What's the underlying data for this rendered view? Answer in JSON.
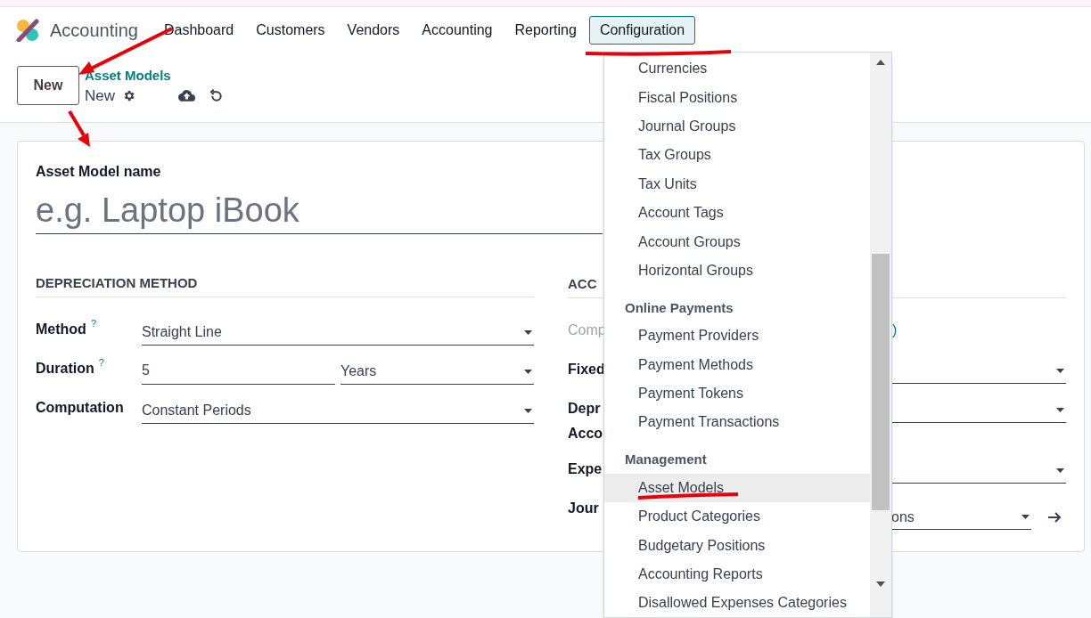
{
  "app": {
    "name": "Accounting"
  },
  "nav": [
    {
      "label": "Dashboard",
      "selected": false
    },
    {
      "label": "Customers",
      "selected": false
    },
    {
      "label": "Vendors",
      "selected": false
    },
    {
      "label": "Accounting",
      "selected": false
    },
    {
      "label": "Reporting",
      "selected": false
    },
    {
      "label": "Configuration",
      "selected": true
    }
  ],
  "control_panel": {
    "new_button": "New",
    "breadcrumb": "Asset Models",
    "record": "New"
  },
  "form": {
    "name_label": "Asset Model name",
    "name_placeholder": "e.g. Laptop iBook",
    "left_section": {
      "title": "DEPRECIATION METHOD",
      "rows": [
        {
          "label": "Method",
          "help": "?",
          "kind": "select",
          "value": "Straight Line"
        },
        {
          "label": "Duration",
          "help": "?",
          "kind": "duration",
          "value": "5",
          "unit": "Years"
        },
        {
          "label": "Computation",
          "kind": "select",
          "value": "Constant Periods"
        }
      ]
    },
    "right_section": {
      "title": "ACC",
      "rows": [
        {
          "label": "Comp",
          "kind": "link",
          "value": ")"
        },
        {
          "label": "Fixed",
          "kind": "select"
        },
        {
          "label": "Depr",
          "label_2": "Acco",
          "kind": "select"
        },
        {
          "label": "Expe",
          "kind": "select"
        },
        {
          "label": "Jour",
          "kind": "journal",
          "value": "ons"
        }
      ]
    }
  },
  "dropdown": {
    "entries": [
      {
        "kind": "item",
        "label": "Currencies",
        "selected": false
      },
      {
        "kind": "item",
        "label": "Fiscal Positions",
        "selected": false
      },
      {
        "kind": "item",
        "label": "Journal Groups",
        "selected": false
      },
      {
        "kind": "item",
        "label": "Tax Groups",
        "selected": false
      },
      {
        "kind": "item",
        "label": "Tax Units",
        "selected": false
      },
      {
        "kind": "item",
        "label": "Account Tags",
        "selected": false
      },
      {
        "kind": "item",
        "label": "Account Groups",
        "selected": false
      },
      {
        "kind": "item",
        "label": "Horizontal Groups",
        "selected": false
      },
      {
        "kind": "header",
        "label": "Online Payments"
      },
      {
        "kind": "item",
        "label": "Payment Providers",
        "selected": false
      },
      {
        "kind": "item",
        "label": "Payment Methods",
        "selected": false
      },
      {
        "kind": "item",
        "label": "Payment Tokens",
        "selected": false
      },
      {
        "kind": "item",
        "label": "Payment Transactions",
        "selected": false
      },
      {
        "kind": "header",
        "label": "Management"
      },
      {
        "kind": "item",
        "label": "Asset Models",
        "selected": true
      },
      {
        "kind": "item",
        "label": "Product Categories",
        "selected": false
      },
      {
        "kind": "item",
        "label": "Budgetary Positions",
        "selected": false
      },
      {
        "kind": "item",
        "label": "Accounting Reports",
        "selected": false
      },
      {
        "kind": "item",
        "label": "Disallowed Expenses Categories",
        "selected": false
      }
    ]
  }
}
